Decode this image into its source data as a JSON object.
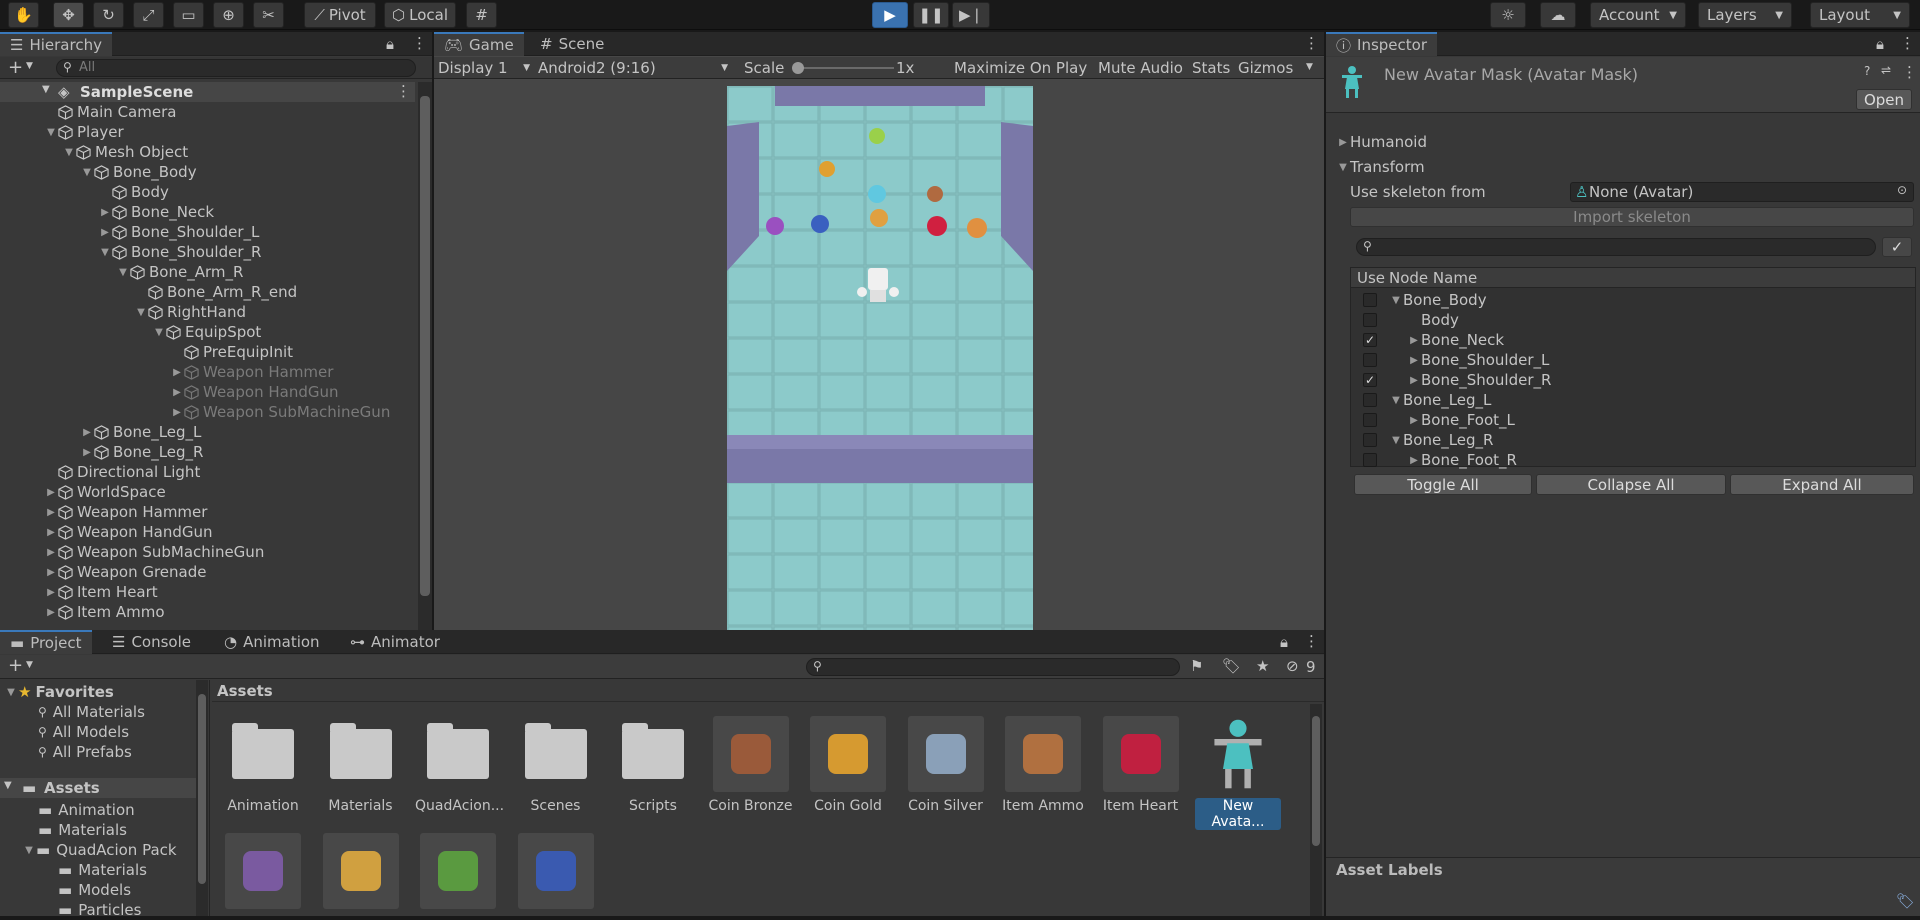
{
  "toolbar": {
    "pivot": "Pivot",
    "local": "Local",
    "account": "Account",
    "layers": "Layers",
    "layout": "Layout"
  },
  "hierarchy": {
    "tab": "Hierarchy",
    "search_placeholder": "All",
    "scene": "SampleScene",
    "items": [
      {
        "label": "Main Camera",
        "depth": 1,
        "arrow": "",
        "dim": false
      },
      {
        "label": "Player",
        "depth": 1,
        "arrow": "open",
        "dim": false
      },
      {
        "label": "Mesh Object",
        "depth": 2,
        "arrow": "open",
        "dim": false
      },
      {
        "label": "Bone_Body",
        "depth": 3,
        "arrow": "open",
        "dim": false
      },
      {
        "label": "Body",
        "depth": 4,
        "arrow": "",
        "dim": false
      },
      {
        "label": "Bone_Neck",
        "depth": 4,
        "arrow": "closed",
        "dim": false
      },
      {
        "label": "Bone_Shoulder_L",
        "depth": 4,
        "arrow": "closed",
        "dim": false
      },
      {
        "label": "Bone_Shoulder_R",
        "depth": 4,
        "arrow": "open",
        "dim": false
      },
      {
        "label": "Bone_Arm_R",
        "depth": 5,
        "arrow": "open",
        "dim": false
      },
      {
        "label": "Bone_Arm_R_end",
        "depth": 6,
        "arrow": "",
        "dim": false
      },
      {
        "label": "RightHand",
        "depth": 6,
        "arrow": "open",
        "dim": false
      },
      {
        "label": "EquipSpot",
        "depth": 7,
        "arrow": "open",
        "dim": false
      },
      {
        "label": "PreEquipInit",
        "depth": 8,
        "arrow": "",
        "dim": false
      },
      {
        "label": "Weapon Hammer",
        "depth": 8,
        "arrow": "closed",
        "dim": true
      },
      {
        "label": "Weapon HandGun",
        "depth": 8,
        "arrow": "closed",
        "dim": true
      },
      {
        "label": "Weapon SubMachineGun",
        "depth": 8,
        "arrow": "closed",
        "dim": true
      },
      {
        "label": "Bone_Leg_L",
        "depth": 3,
        "arrow": "closed",
        "dim": false
      },
      {
        "label": "Bone_Leg_R",
        "depth": 3,
        "arrow": "closed",
        "dim": false
      },
      {
        "label": "Directional Light",
        "depth": 1,
        "arrow": "",
        "dim": false
      },
      {
        "label": "WorldSpace",
        "depth": 1,
        "arrow": "closed",
        "dim": false
      },
      {
        "label": "Weapon Hammer",
        "depth": 1,
        "arrow": "closed",
        "dim": false
      },
      {
        "label": "Weapon HandGun",
        "depth": 1,
        "arrow": "closed",
        "dim": false
      },
      {
        "label": "Weapon SubMachineGun",
        "depth": 1,
        "arrow": "closed",
        "dim": false
      },
      {
        "label": "Weapon Grenade",
        "depth": 1,
        "arrow": "closed",
        "dim": false
      },
      {
        "label": "Item Heart",
        "depth": 1,
        "arrow": "closed",
        "dim": false
      },
      {
        "label": "Item Ammo",
        "depth": 1,
        "arrow": "closed",
        "dim": false
      }
    ]
  },
  "game": {
    "tab_game": "Game",
    "tab_scene": "Scene",
    "display": "Display 1",
    "resolution": "Android2 (9:16)",
    "scale_label": "Scale",
    "scale_value": "1x",
    "maximize": "Maximize On Play",
    "mute": "Mute Audio",
    "stats": "Stats",
    "gizmos": "Gizmos"
  },
  "inspector": {
    "tab": "Inspector",
    "title": "New Avatar Mask (Avatar Mask)",
    "open": "Open",
    "humanoid": "Humanoid",
    "transform": "Transform",
    "skeleton_label": "Use skeleton from",
    "skeleton_value": "None (Avatar)",
    "import": "Import skeleton",
    "col_use": "Use",
    "col_node": "Node Name",
    "nodes": [
      {
        "label": "Bone_Body",
        "depth": 0,
        "arrow": "open",
        "checked": false
      },
      {
        "label": "Body",
        "depth": 1,
        "arrow": "",
        "checked": false
      },
      {
        "label": "Bone_Neck",
        "depth": 1,
        "arrow": "closed",
        "checked": true
      },
      {
        "label": "Bone_Shoulder_L",
        "depth": 1,
        "arrow": "closed",
        "checked": false
      },
      {
        "label": "Bone_Shoulder_R",
        "depth": 1,
        "arrow": "closed",
        "checked": true
      },
      {
        "label": "Bone_Leg_L",
        "depth": 0,
        "arrow": "open",
        "checked": false
      },
      {
        "label": "Bone_Foot_L",
        "depth": 1,
        "arrow": "closed",
        "checked": false
      },
      {
        "label": "Bone_Leg_R",
        "depth": 0,
        "arrow": "open",
        "checked": false
      },
      {
        "label": "Bone_Foot_R",
        "depth": 1,
        "arrow": "closed",
        "checked": false
      }
    ],
    "toggle_all": "Toggle All",
    "collapse_all": "Collapse All",
    "expand_all": "Expand All",
    "asset_labels": "Asset Labels"
  },
  "bottom": {
    "tabs": [
      "Project",
      "Console",
      "Animation",
      "Animator"
    ],
    "hidden_count": "9",
    "breadcrumb": "Assets",
    "favorites": {
      "title": "Favorites",
      "items": [
        "All Materials",
        "All Models",
        "All Prefabs"
      ]
    },
    "tree": {
      "root": "Assets",
      "items": [
        {
          "label": "Animation",
          "depth": 1
        },
        {
          "label": "Materials",
          "depth": 1
        },
        {
          "label": "QuadAcion Pack",
          "depth": 1
        },
        {
          "label": "Materials",
          "depth": 2
        },
        {
          "label": "Models",
          "depth": 2
        },
        {
          "label": "Particles",
          "depth": 2
        }
      ]
    },
    "assets": [
      {
        "label": "Animation",
        "kind": "folder",
        "color": "#c9c9c9"
      },
      {
        "label": "Materials",
        "kind": "folder",
        "color": "#c9c9c9"
      },
      {
        "label": "QuadAcion...",
        "kind": "folder",
        "color": "#c9c9c9"
      },
      {
        "label": "Scenes",
        "kind": "folder",
        "color": "#c9c9c9"
      },
      {
        "label": "Scripts",
        "kind": "folder",
        "color": "#c9c9c9"
      },
      {
        "label": "Coin Bronze",
        "kind": "tile",
        "color": "#9a5a3a"
      },
      {
        "label": "Coin Gold",
        "kind": "tile",
        "color": "#d69a30"
      },
      {
        "label": "Coin Silver",
        "kind": "tile",
        "color": "#8aa0b8"
      },
      {
        "label": "Item Ammo",
        "kind": "tile",
        "color": "#b07040"
      },
      {
        "label": "Item Heart",
        "kind": "tile",
        "color": "#c02040"
      },
      {
        "label": "New Avata...",
        "kind": "avatar",
        "color": "#4cc0c0"
      },
      {
        "label": "",
        "kind": "tile",
        "color": "#7a5aa0"
      },
      {
        "label": "",
        "kind": "tile",
        "color": "#d0a040"
      },
      {
        "label": "",
        "kind": "tile",
        "color": "#5a9a40"
      },
      {
        "label": "",
        "kind": "tile",
        "color": "#3a5ab0"
      }
    ]
  }
}
